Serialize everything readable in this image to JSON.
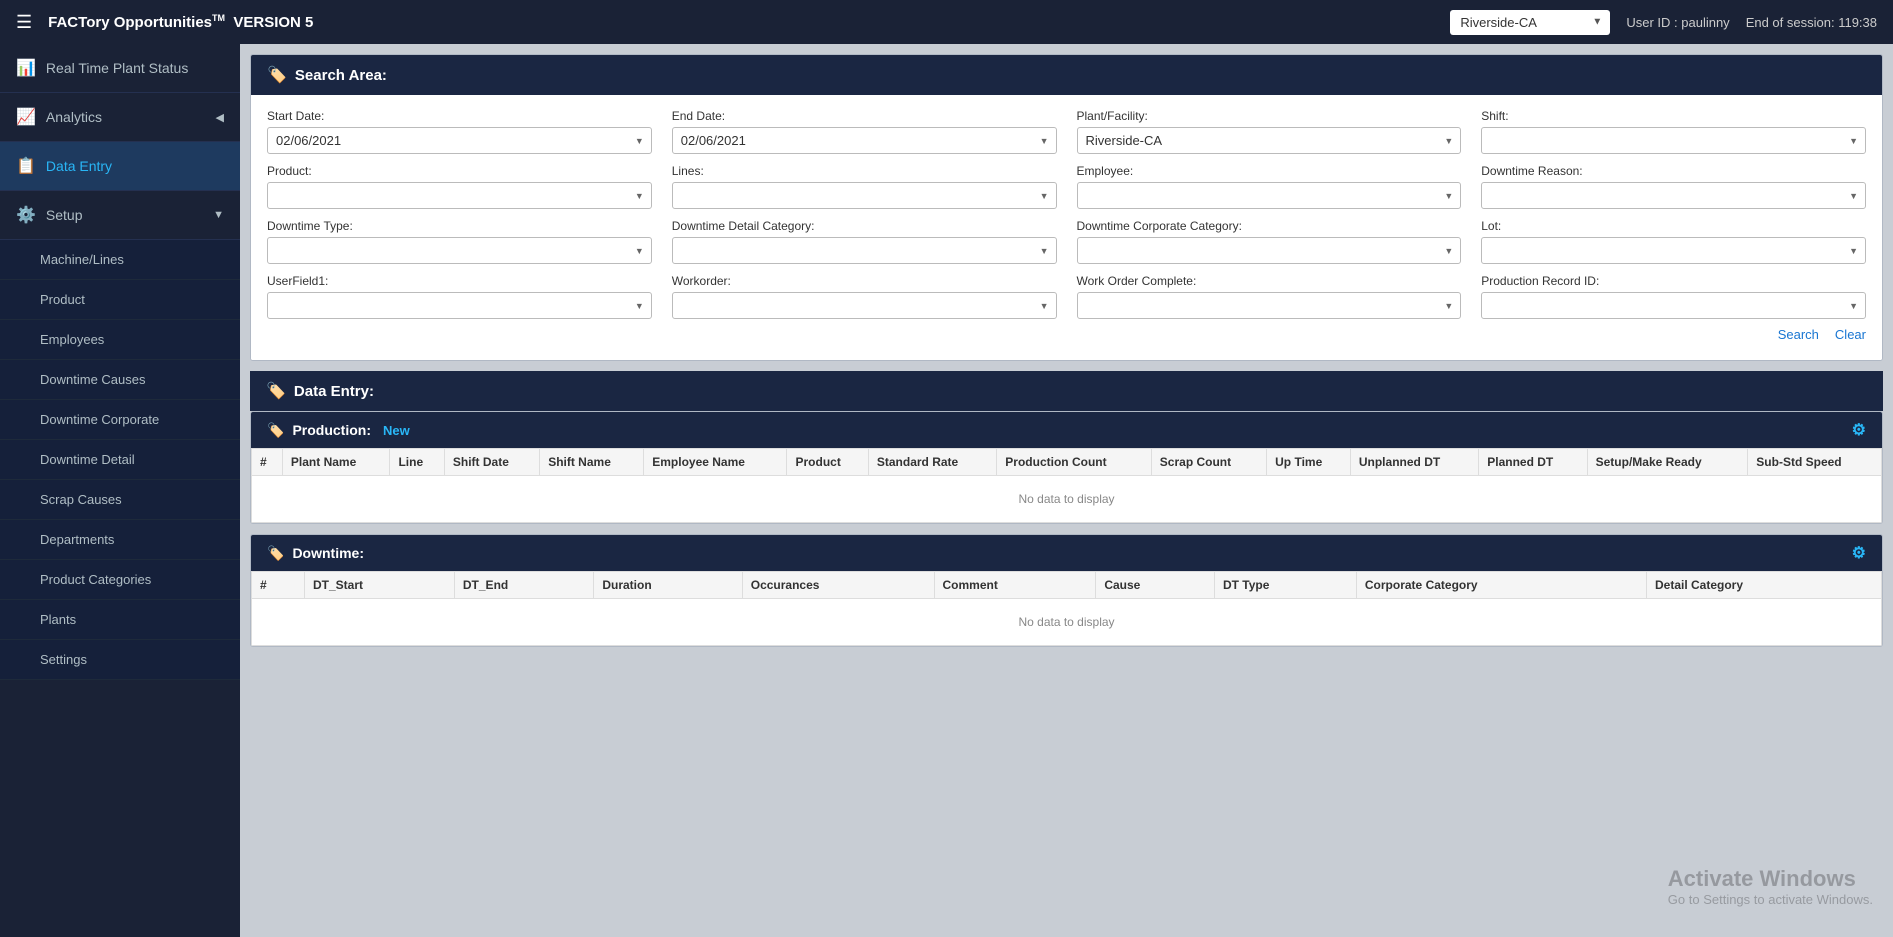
{
  "topNav": {
    "hamburger_icon": "☰",
    "title": "FACTory Opportunities",
    "title_tm": "TM",
    "version": "VERSION 5",
    "facility_options": [
      "Riverside-CA"
    ],
    "facility_selected": "Riverside-CA",
    "user_label": "User ID :",
    "user_value": "paulinny",
    "session_label": "End of session:",
    "session_value": "119:38"
  },
  "sidebar": {
    "items": [
      {
        "id": "real-time",
        "label": "Real Time Plant Status",
        "icon": "📊",
        "active": false,
        "hasArrow": false
      },
      {
        "id": "analytics",
        "label": "Analytics",
        "icon": "📈",
        "active": false,
        "hasArrow": true
      },
      {
        "id": "data-entry",
        "label": "Data Entry",
        "icon": "📋",
        "active": true,
        "hasArrow": false
      }
    ],
    "setup": {
      "label": "Setup",
      "icon": "⚙️",
      "arrow": "▼",
      "sub_items": [
        {
          "id": "machine-lines",
          "label": "Machine/Lines"
        },
        {
          "id": "product",
          "label": "Product"
        },
        {
          "id": "employees",
          "label": "Employees"
        },
        {
          "id": "downtime-causes",
          "label": "Downtime Causes"
        },
        {
          "id": "downtime-corporate",
          "label": "Downtime Corporate"
        },
        {
          "id": "downtime-detail",
          "label": "Downtime Detail"
        },
        {
          "id": "scrap-causes",
          "label": "Scrap Causes"
        },
        {
          "id": "departments",
          "label": "Departments"
        },
        {
          "id": "product-categories",
          "label": "Product Categories"
        },
        {
          "id": "plants",
          "label": "Plants"
        },
        {
          "id": "settings",
          "label": "Settings"
        }
      ]
    }
  },
  "searchArea": {
    "header": "Search Area:",
    "header_icon": "🏷️",
    "fields": {
      "start_date_label": "Start Date:",
      "start_date_value": "02/06/2021",
      "end_date_label": "End Date:",
      "end_date_value": "02/06/2021",
      "plant_label": "Plant/Facility:",
      "plant_value": "Riverside-CA",
      "shift_label": "Shift:",
      "shift_value": "",
      "product_label": "Product:",
      "product_value": "",
      "lines_label": "Lines:",
      "lines_value": "",
      "employee_label": "Employee:",
      "employee_value": "",
      "downtime_reason_label": "Downtime Reason:",
      "downtime_reason_value": "",
      "downtime_type_label": "Downtime Type:",
      "downtime_type_value": "",
      "downtime_detail_label": "Downtime Detail Category:",
      "downtime_detail_value": "",
      "downtime_corporate_label": "Downtime Corporate Category:",
      "downtime_corporate_value": "",
      "lot_label": "Lot:",
      "lot_value": "",
      "userfield1_label": "UserField1:",
      "userfield1_value": "",
      "workorder_label": "Workorder:",
      "workorder_value": "",
      "work_order_complete_label": "Work Order Complete:",
      "work_order_complete_value": "",
      "production_record_label": "Production Record ID:",
      "production_record_value": ""
    },
    "search_btn": "Search",
    "clear_btn": "Clear"
  },
  "dataEntry": {
    "header": "Data Entry:",
    "header_icon": "🏷️",
    "production": {
      "header": "Production:",
      "new_label": "New",
      "gear_icon": "⚙",
      "columns": [
        "#",
        "Plant Name",
        "Line",
        "Shift Date",
        "Shift Name",
        "Employee Name",
        "Product",
        "Standard Rate",
        "Production Count",
        "Scrap Count",
        "Up Time",
        "Unplanned DT",
        "Planned DT",
        "Setup/Make Ready",
        "Sub-Std Speed"
      ],
      "no_data": "No data to display"
    },
    "downtime": {
      "header": "Downtime:",
      "gear_icon": "⚙",
      "columns": [
        "#",
        "DT_Start",
        "DT_End",
        "Duration",
        "Occurances",
        "Comment",
        "Cause",
        "DT Type",
        "Corporate Category",
        "Detail Category"
      ],
      "no_data": "No data to display"
    }
  },
  "watermark": {
    "line1": "Activate Windows",
    "line2": "Go to Settings to activate Windows."
  }
}
